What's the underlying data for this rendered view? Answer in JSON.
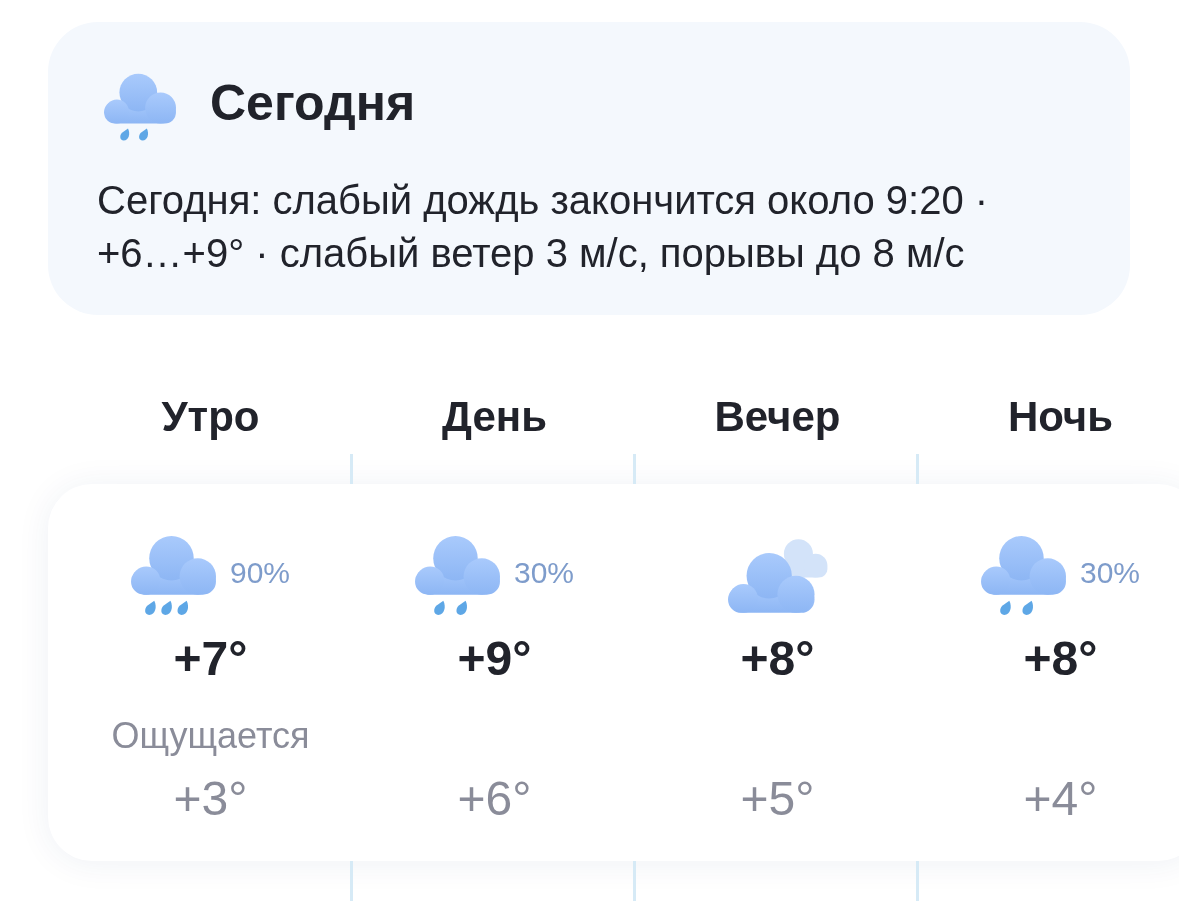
{
  "summary": {
    "kind": "light-rain",
    "title": "Сегодня",
    "description": "Сегодня: слабый дождь закончится около 9:20 · +6…+9° · слабый ветер 3 м/с, порывы до 8 м/с"
  },
  "periods": [
    {
      "name": "Утро",
      "kind": "heavy-rain",
      "precipitation": "90%",
      "temperature": "+7°",
      "feels_like_label": "Ощущается",
      "feels_like": "+3°"
    },
    {
      "name": "День",
      "kind": "light-rain",
      "precipitation": "30%",
      "temperature": "+9°",
      "feels_like": "+6°"
    },
    {
      "name": "Вечер",
      "kind": "cloudy",
      "temperature": "+8°",
      "feels_like": "+5°"
    },
    {
      "name": "Ночь",
      "kind": "light-rain",
      "precipitation": "30%",
      "temperature": "+8°",
      "feels_like": "+4°"
    }
  ]
}
